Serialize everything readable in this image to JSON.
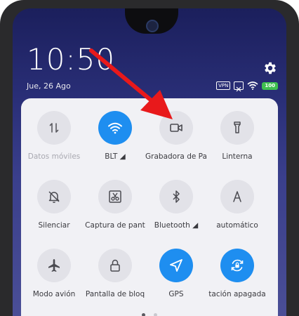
{
  "status": {
    "time": "10:50",
    "date": "Jue, 26 Ago",
    "vpn": "VPN",
    "battery": "100"
  },
  "tiles": [
    {
      "label": "Datos móviles",
      "icon": "data-arrows-icon",
      "active": false,
      "dim": true
    },
    {
      "label": "BLT ◢",
      "icon": "wifi-icon",
      "active": true,
      "dim": false
    },
    {
      "label": "Grabadora de Pa",
      "icon": "screen-recorder-icon",
      "active": false,
      "dim": false
    },
    {
      "label": "Linterna",
      "icon": "flashlight-icon",
      "active": false,
      "dim": false
    },
    {
      "label": "Silenciar",
      "icon": "bell-off-icon",
      "active": false,
      "dim": false
    },
    {
      "label": "Captura de pant",
      "icon": "screenshot-scissors-icon",
      "active": false,
      "dim": false
    },
    {
      "label": "Bluetooth ◢",
      "icon": "bluetooth-icon",
      "active": false,
      "dim": false
    },
    {
      "label": "automático",
      "icon": "auto-brightness-icon",
      "active": false,
      "dim": false
    },
    {
      "label": "Modo avión",
      "icon": "airplane-icon",
      "active": false,
      "dim": false
    },
    {
      "label": "Pantalla de bloq",
      "icon": "lock-icon",
      "active": false,
      "dim": false
    },
    {
      "label": "GPS",
      "icon": "gps-icon",
      "active": true,
      "dim": false
    },
    {
      "label": "tación apagada",
      "icon": "rotation-lock-icon",
      "active": true,
      "dim": false
    }
  ],
  "colors": {
    "accent": "#1e8ef0",
    "arrow": "#e8191b",
    "battery": "#3fbf4f"
  }
}
